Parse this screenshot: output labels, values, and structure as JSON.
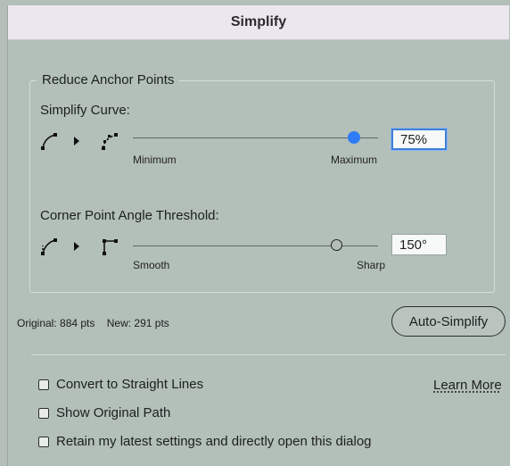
{
  "dialog": {
    "title": "Simplify"
  },
  "reduce_anchor_points": {
    "group_label": "Reduce Anchor Points",
    "simplify_curve": {
      "label": "Simplify Curve:",
      "min_label": "Minimum",
      "max_label": "Maximum",
      "value": "75%",
      "slider_level": 0.9,
      "accent": "#2f7cf6"
    },
    "corner_angle": {
      "label": "Corner Point Angle Threshold:",
      "min_label": "Smooth",
      "max_label": "Sharp",
      "value": "150°",
      "slider_level": 0.83
    }
  },
  "stats": {
    "original": "Original: 884 pts",
    "new": "New: 291 pts"
  },
  "buttons": {
    "auto_simplify": "Auto-Simplify"
  },
  "options": [
    {
      "label": "Convert to Straight Lines",
      "checked": false
    },
    {
      "label": "Show Original Path",
      "checked": false
    },
    {
      "label": "Retain my latest settings and directly open this dialog",
      "checked": false
    }
  ],
  "links": {
    "learn_more": "Learn More"
  },
  "icons": [
    "curve-before-icon",
    "arrow-right-icon",
    "curve-after-icon",
    "corner-before-icon",
    "corner-after-icon"
  ]
}
